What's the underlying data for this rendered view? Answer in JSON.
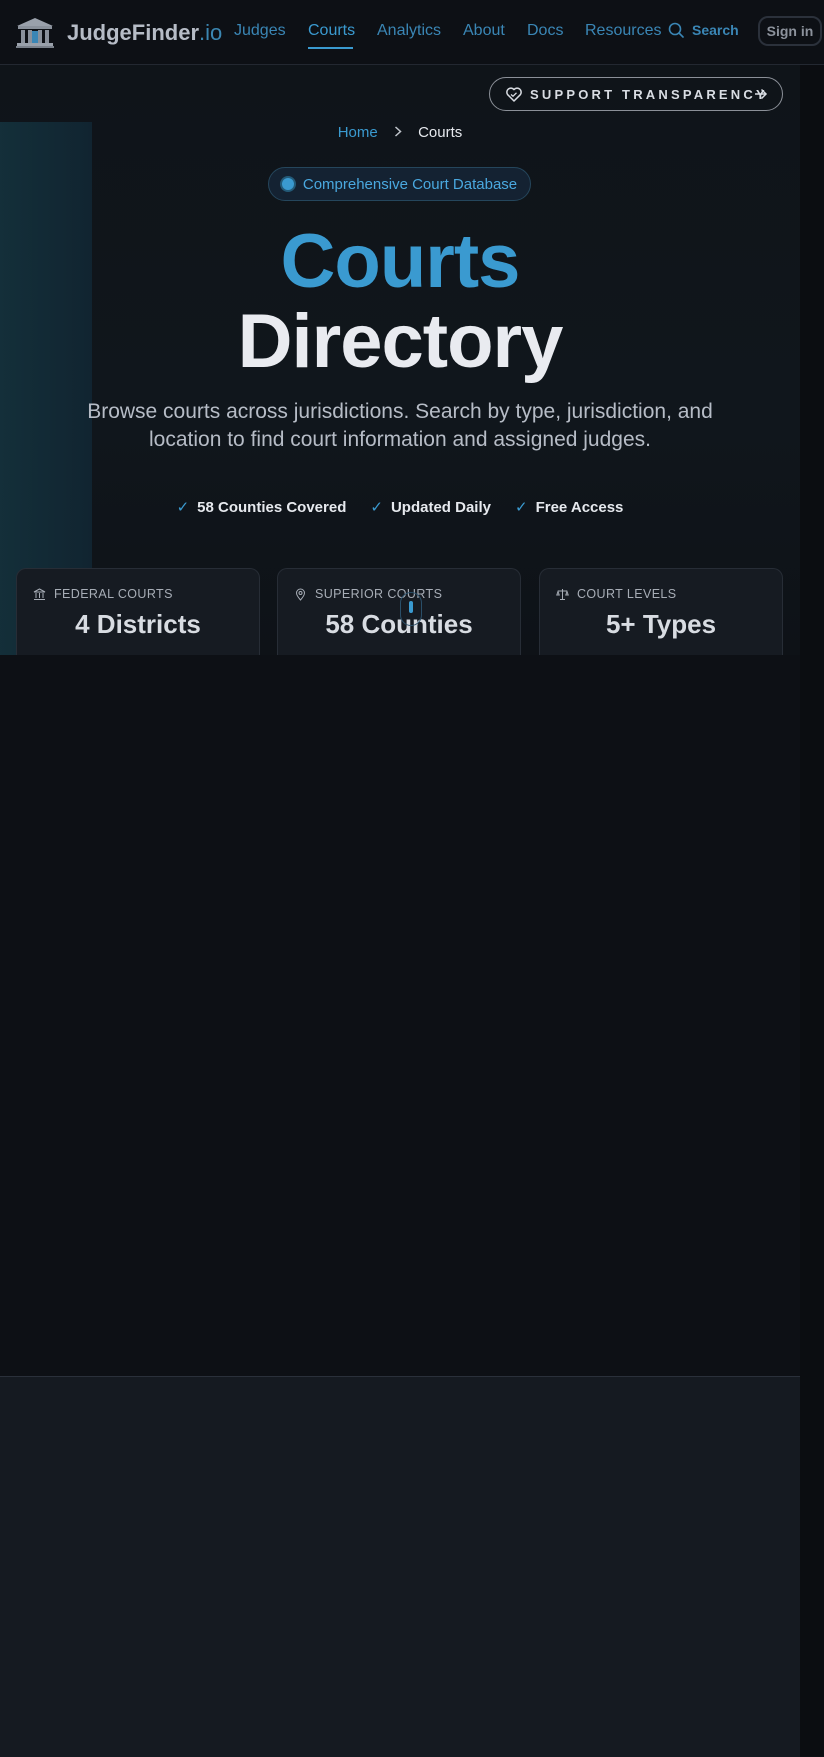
{
  "header": {
    "brand": "JudgeFinder",
    "brand_tld": ".io",
    "nav": [
      "Judges",
      "Courts",
      "Analytics",
      "About",
      "Docs",
      "Resources"
    ],
    "active_nav": "Courts",
    "search_label": "Search",
    "signin_label": "Sign in"
  },
  "support": {
    "label": "SUPPORT TRANSPARENCY"
  },
  "breadcrumb": {
    "home": "Home",
    "current": "Courts"
  },
  "hero": {
    "pill": "Comprehensive Court Database",
    "title_line1": "Courts",
    "title_line2": "Directory",
    "subtitle": "Browse courts across jurisdictions. Search by type, jurisdiction, and location to find court information and assigned judges.",
    "features": [
      "58 Counties Covered",
      "Updated Daily",
      "Free Access"
    ]
  },
  "stats": [
    {
      "label": "FEDERAL COURTS",
      "value": "4 Districts",
      "icon": "building-icon"
    },
    {
      "label": "SUPERIOR COURTS",
      "value": "58 Counties",
      "icon": "map-pin-icon"
    },
    {
      "label": "COURT LEVELS",
      "value": "5+ Types",
      "icon": "scales-icon"
    }
  ],
  "colors": {
    "accent": "#3a9ad0",
    "background": "#0d1015",
    "card": "#161b22"
  }
}
